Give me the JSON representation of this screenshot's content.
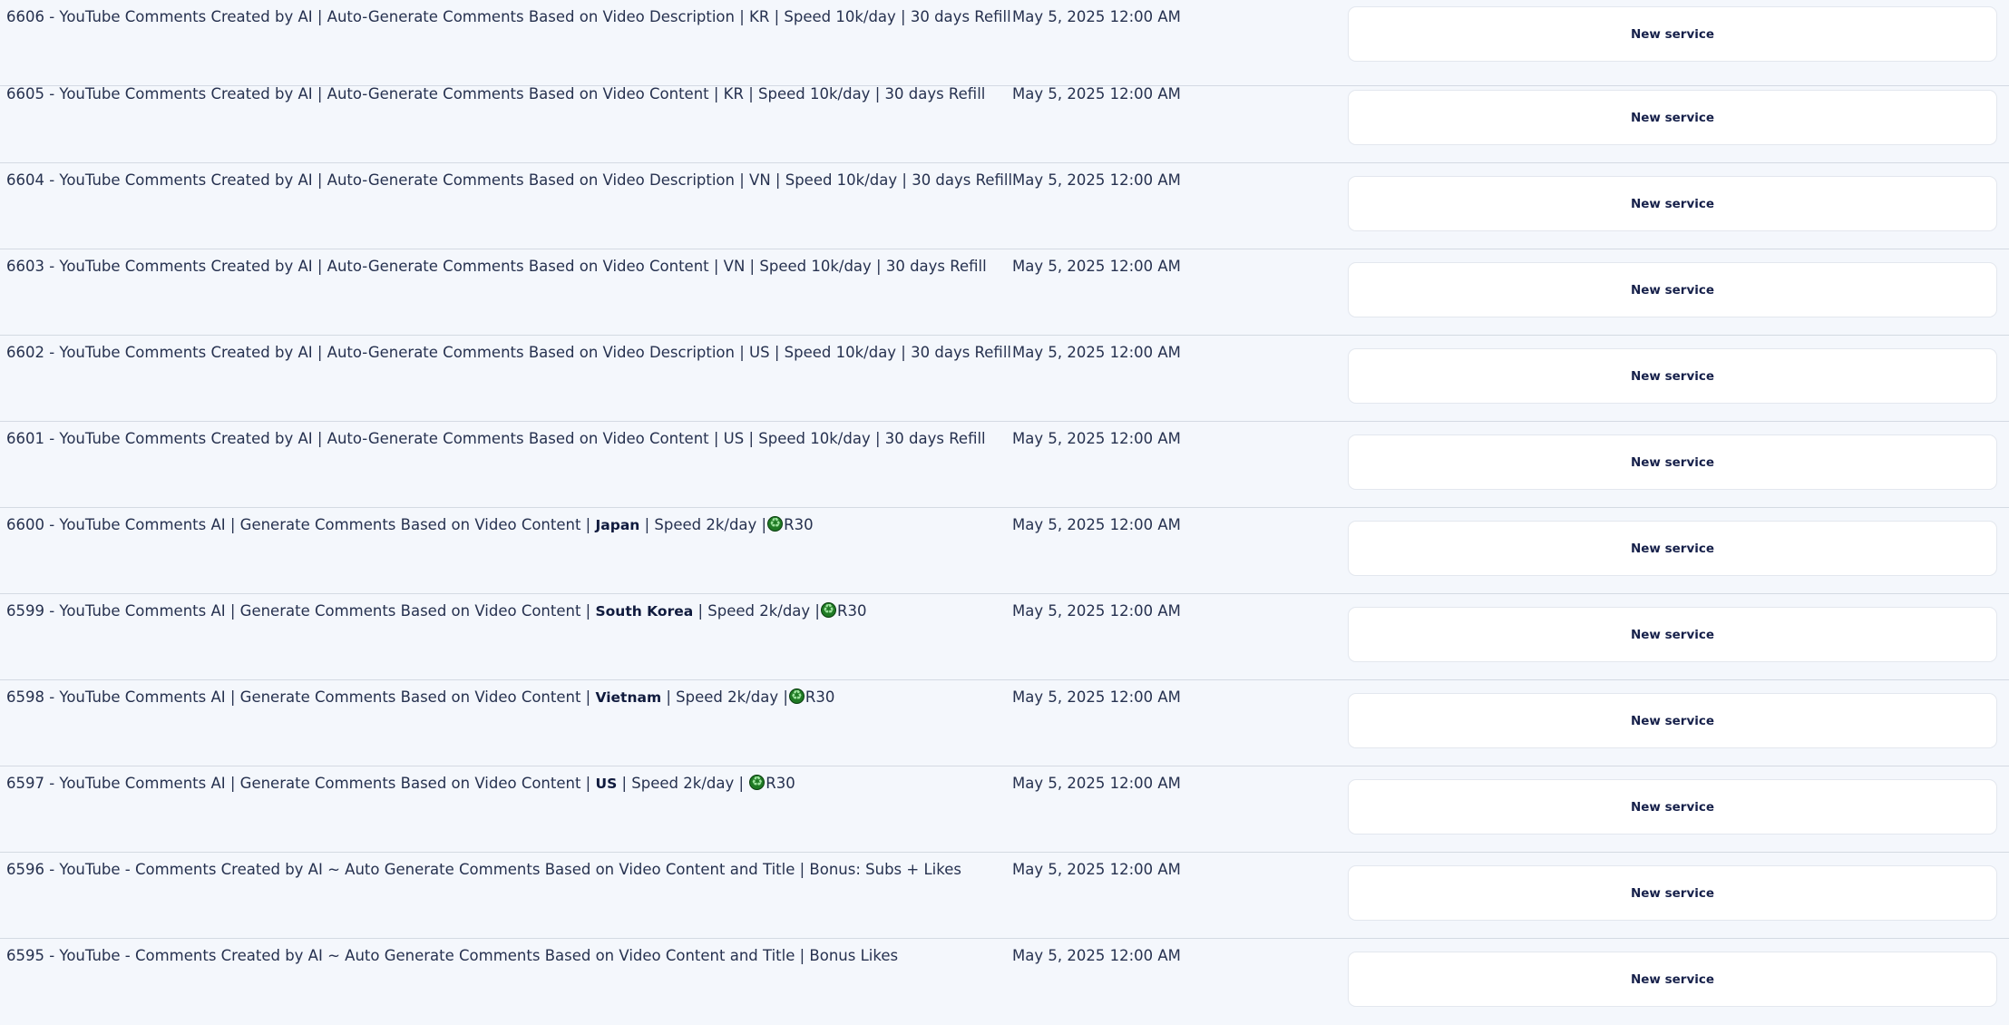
{
  "rows": [
    {
      "name": "6606 - YouTube Comments Created by AI | Auto-Generate Comments Based on Video Description | KR | Speed 10k/day | 30 days Refill",
      "date": "May 5, 2025 12:00 AM",
      "status": "New service"
    },
    {
      "name": "6605 - YouTube Comments Created by AI | Auto-Generate Comments Based on Video Content | KR | Speed 10k/day | 30 days Refill",
      "date": "May 5, 2025 12:00 AM",
      "status": "New service"
    },
    {
      "name": "6604 - YouTube Comments Created by AI | Auto-Generate Comments Based on Video Description | VN | Speed 10k/day | 30 days Refill",
      "date": "May 5, 2025 12:00 AM",
      "status": "New service"
    },
    {
      "name": "6603 - YouTube Comments Created by AI | Auto-Generate Comments Based on Video Content | VN | Speed 10k/day | 30 days Refill",
      "date": "May 5, 2025 12:00 AM",
      "status": "New service"
    },
    {
      "name": "6602 - YouTube Comments Created by AI | Auto-Generate Comments Based on Video Description | US | Speed 10k/day | 30 days Refill",
      "date": "May 5, 2025 12:00 AM",
      "status": "New service"
    },
    {
      "name": "6601 - YouTube Comments Created by AI | Auto-Generate Comments Based on Video Content | US | Speed 10k/day | 30 days Refill",
      "date": "May 5, 2025 12:00 AM",
      "status": "New service"
    },
    {
      "name_prefix": "6600 - YouTube Comments AI | Generate Comments Based on Video Content | ",
      "name_bold": "Japan",
      "name_suffix": " | Speed 2k/day |",
      "name_tail": "R30",
      "icon": "recycle-icon",
      "date": "May 5, 2025 12:00 AM",
      "status": "New service"
    },
    {
      "name_prefix": "6599 - YouTube Comments AI | Generate Comments Based on Video Content | ",
      "name_bold": "South Korea",
      "name_suffix": " | Speed 2k/day |",
      "name_tail": "R30",
      "icon": "recycle-icon",
      "date": "May 5, 2025 12:00 AM",
      "status": "New service"
    },
    {
      "name_prefix": "6598 - YouTube Comments AI | Generate Comments Based on Video Content | ",
      "name_bold": "Vietnam",
      "name_suffix": " | Speed 2k/day |",
      "name_tail": "R30",
      "icon": "recycle-icon",
      "date": "May 5, 2025 12:00 AM",
      "status": "New service"
    },
    {
      "name_prefix": "6597 - YouTube Comments AI | Generate Comments Based on Video Content | ",
      "name_bold": "US",
      "name_suffix": " | Speed 2k/day | ",
      "name_tail": "R30",
      "icon": "recycle-icon",
      "date": "May 5, 2025 12:00 AM",
      "status": "New service"
    },
    {
      "name": "6596 - YouTube - Comments Created by AI ~ Auto Generate Comments Based on Video Content and Title | Bonus: Subs + Likes",
      "date": "May 5, 2025 12:00 AM",
      "status": "New service"
    },
    {
      "name": "6595 - YouTube - Comments Created by AI ~ Auto Generate Comments Based on Video Content and Title | Bonus Likes",
      "date": "May 5, 2025 12:00 AM",
      "status": "New service"
    }
  ]
}
